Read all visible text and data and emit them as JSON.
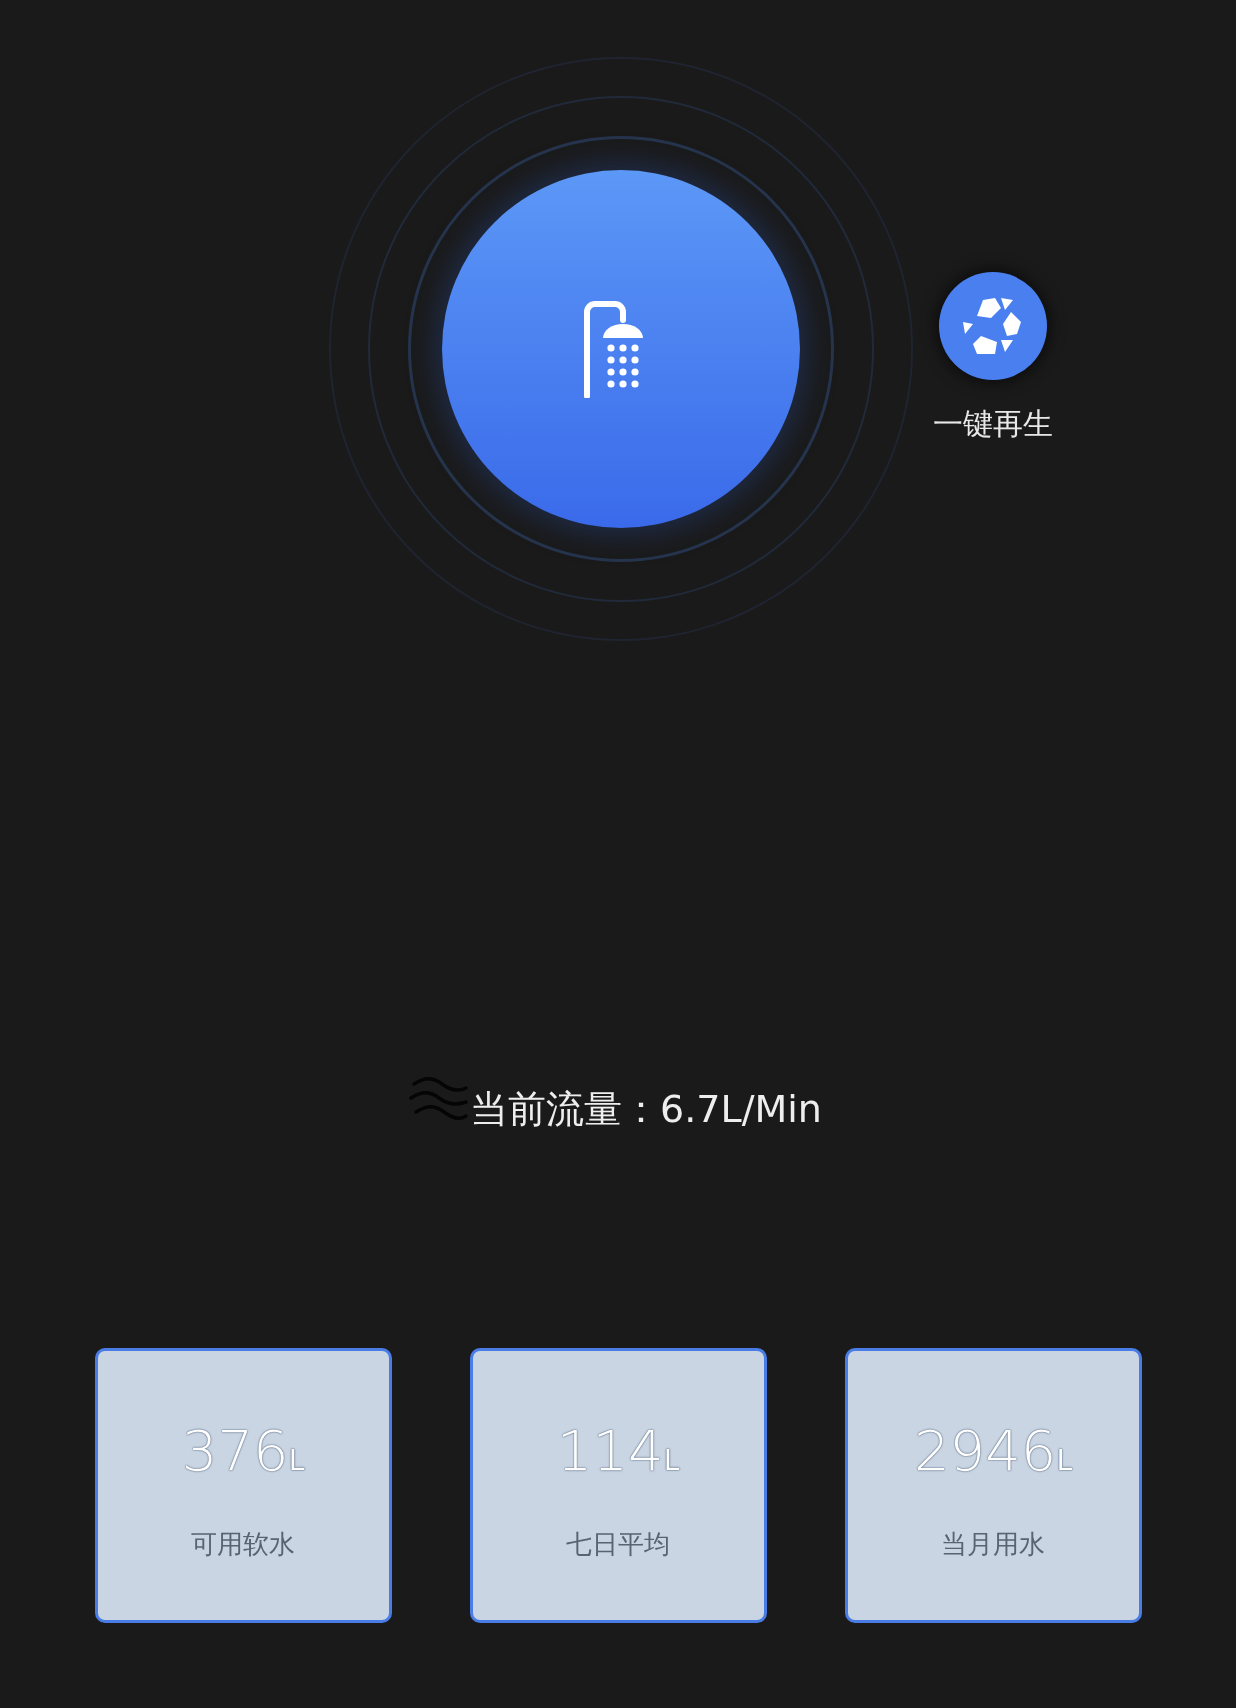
{
  "regenerate": {
    "label": "一键再生"
  },
  "flow": {
    "text": "当前流量：6.7L/Min"
  },
  "stats": [
    {
      "value": "376$_{L}$",
      "label": "可用软水"
    },
    {
      "value": "114$_{L}$",
      "label": "七日平均"
    },
    {
      "value": "2946$_{L}$",
      "label": "当月用水"
    }
  ]
}
